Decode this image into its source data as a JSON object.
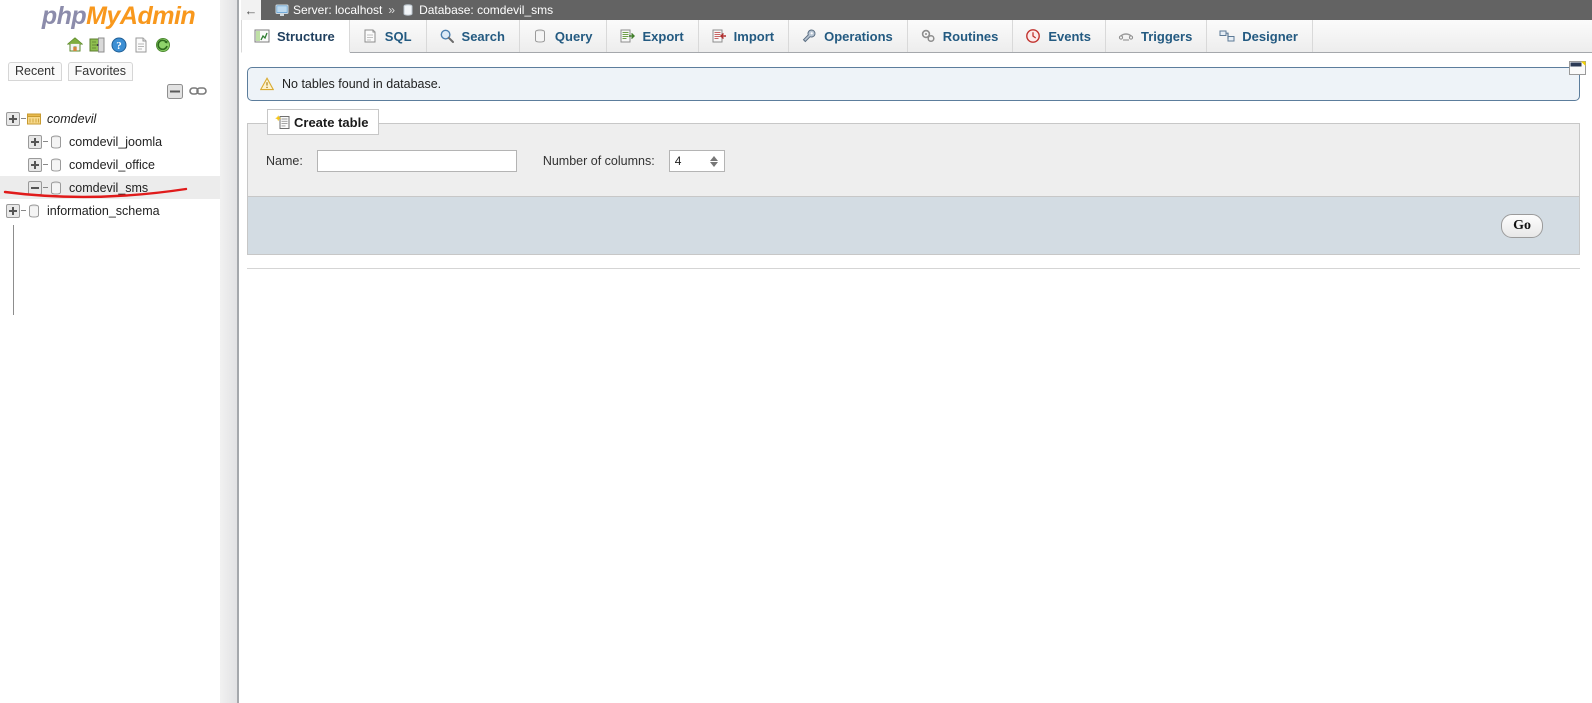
{
  "app": {
    "logo_php": "php",
    "logo_myadmin": "MyAdmin",
    "accent_orange": "#f8981d",
    "accent_php_gray": "#8c8cab",
    "breadcrumb_bg": "#636363",
    "footer_bar_bg": "#d3dce3",
    "annotation_color": "#e01b1b"
  },
  "sidebar": {
    "nav_icons": [
      {
        "name": "home-icon",
        "title": "Home"
      },
      {
        "name": "logout-icon",
        "title": "Log out"
      },
      {
        "name": "docs-icon",
        "title": "phpMyAdmin documentation"
      },
      {
        "name": "sql-docs-icon",
        "title": "Documentation"
      },
      {
        "name": "reload-icon",
        "title": "Reload navigation"
      }
    ],
    "tabs": [
      {
        "label": "Recent",
        "name": "sidebar-tab-recent"
      },
      {
        "label": "Favorites",
        "name": "sidebar-tab-favorites"
      }
    ],
    "tree_controls": [
      {
        "name": "collapse-all-icon",
        "title": "Collapse all"
      },
      {
        "name": "link-with-main-panel-icon",
        "title": "Link with main panel"
      }
    ],
    "tree": [
      {
        "label": "comdevil",
        "state": "expanded",
        "level": 0,
        "icon": "database-group-icon",
        "selected": false,
        "italic": true
      },
      {
        "label": "comdevil_joomla",
        "state": "collapsed",
        "level": 1,
        "icon": "database-icon",
        "selected": false,
        "italic": false
      },
      {
        "label": "comdevil_office",
        "state": "collapsed",
        "level": 1,
        "icon": "database-icon",
        "selected": false,
        "italic": false
      },
      {
        "label": "comdevil_sms",
        "state": "expanded",
        "level": 1,
        "icon": "database-icon",
        "selected": true,
        "italic": false
      },
      {
        "label": "information_schema",
        "state": "collapsed",
        "level": 0,
        "icon": "database-icon",
        "selected": false,
        "italic": false
      }
    ]
  },
  "breadcrumb": {
    "back_glyph": "←",
    "server_label": "Server: localhost",
    "separator": "»",
    "database_label": "Database: comdevil_sms"
  },
  "tabs": [
    {
      "label": "Structure",
      "icon": "structure-icon",
      "active": true
    },
    {
      "label": "SQL",
      "icon": "sql-icon",
      "active": false
    },
    {
      "label": "Search",
      "icon": "search-icon",
      "active": false
    },
    {
      "label": "Query",
      "icon": "query-icon",
      "active": false
    },
    {
      "label": "Export",
      "icon": "export-icon",
      "active": false
    },
    {
      "label": "Import",
      "icon": "import-icon",
      "active": false
    },
    {
      "label": "Operations",
      "icon": "operations-icon",
      "active": false
    },
    {
      "label": "Routines",
      "icon": "routines-icon",
      "active": false
    },
    {
      "label": "Events",
      "icon": "events-icon",
      "active": false
    },
    {
      "label": "Triggers",
      "icon": "triggers-icon",
      "active": false
    },
    {
      "label": "Designer",
      "icon": "designer-icon",
      "active": false
    }
  ],
  "notice": {
    "text": "No tables found in database.",
    "icon": "warning-icon"
  },
  "create_table": {
    "legend": "Create table",
    "legend_icon": "new-table-icon",
    "name_label": "Name:",
    "name_value": "",
    "name_placeholder": "",
    "columns_label": "Number of columns:",
    "columns_value": "4",
    "go_label": "Go"
  },
  "footer": {
    "console_icon": "console-icon"
  }
}
